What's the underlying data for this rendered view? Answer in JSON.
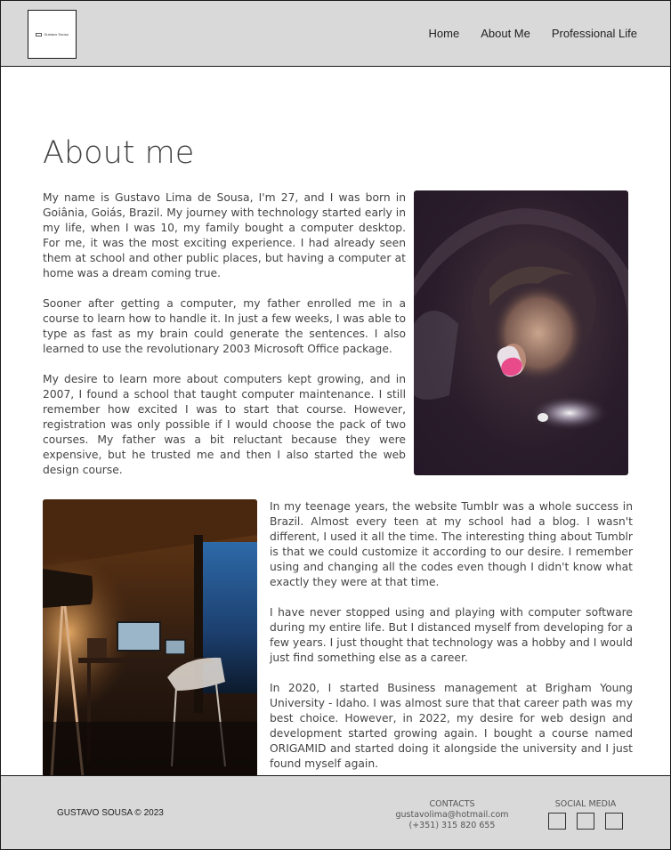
{
  "header": {
    "logo_text": "Gustavo Sousa",
    "nav": [
      {
        "label": "Home"
      },
      {
        "label": "About Me"
      },
      {
        "label": "Professional Life"
      }
    ]
  },
  "main": {
    "title": "About me",
    "section1": [
      "My name is Gustavo Lima de Sousa, I'm 27, and I was born in Goiânia, Goiás, Brazil. My journey with technology started early in my life, when I was 10, my family bought a computer desktop. For me, it was the most exciting experience. I had already seen them at school and other public places, but having a computer at home was a dream coming true.",
      "Sooner after getting a computer, my father enrolled me in a course to learn how to handle it. In just a few weeks, I was able to type as fast as my brain could generate the sentences. I also learned to use the revolutionary 2003 Microsoft Office package.",
      "My desire to learn more about computers kept growing, and in 2007, I found a school that taught computer maintenance. I still remember how excited I was to start that course. However, registration was only possible if I would choose the pack of two courses. My father was a bit reluctant because they were expensive, but he trusted me and then I also started the web design course."
    ],
    "section2": [
      "In my teenage years, the website Tumblr was a whole success in Brazil. Almost every teen at my school had a blog. I wasn't different, I used it all the time. The interesting thing about Tumblr is that we could customize it according to our desire. I remember using and changing all the codes even though I didn't know what exactly they were at that time.",
      "I have never stopped using and playing with computer software during my entire life. But I distanced myself from developing for a few years. I just thought that technology was a hobby and I would just find something else as a career.",
      "In 2020, I started Business management at Brigham Young University - Idaho. I was almost sure that that career path was my best choice. However, in 2022, my desire for web design and development started growing again. I bought a course named ORIGAMID and started doing it alongside the university and I just found myself again."
    ]
  },
  "footer": {
    "copyright": "GUSTAVO SOUSA © 2023",
    "contacts_title": "CONTACTS",
    "email": "gustavolima@hotmail.com",
    "phone": "(+351) 315 820 655",
    "social_title": "SOCIAL MEDIA"
  }
}
